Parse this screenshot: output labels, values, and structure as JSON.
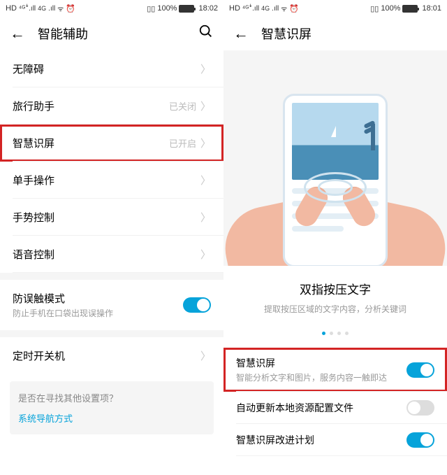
{
  "left": {
    "status": {
      "time": "18:02",
      "battery": "100%",
      "hd": "HD",
      "net": "4G"
    },
    "title": "智能辅助",
    "rows": [
      {
        "label": "无障碍",
        "value": ""
      },
      {
        "label": "旅行助手",
        "value": "已关闭"
      },
      {
        "label": "智慧识屏",
        "value": "已开启",
        "hl": true
      },
      {
        "label": "单手操作",
        "value": ""
      },
      {
        "label": "手势控制",
        "value": ""
      },
      {
        "label": "语音控制",
        "value": ""
      }
    ],
    "antitouch": {
      "label": "防误触模式",
      "desc": "防止手机在口袋出现误操作",
      "on": true
    },
    "timer": {
      "label": "定时开关机"
    },
    "hint": {
      "q": "是否在寻找其他设置项？",
      "link": "系统导航方式"
    }
  },
  "right": {
    "status": {
      "time": "18:01",
      "battery": "100%",
      "hd": "HD",
      "net": "4G"
    },
    "title": "智慧识屏",
    "caption": {
      "title": "双指按压文字",
      "sub": "提取按压区域的文字内容，分析关键词"
    },
    "items": [
      {
        "label": "智慧识屏",
        "desc": "智能分析文字和图片，服务内容一触即达",
        "on": true,
        "hl": true
      },
      {
        "label": "自动更新本地资源配置文件",
        "on": false
      },
      {
        "label": "智慧识屏改进计划",
        "desc": "",
        "on": true
      }
    ]
  }
}
